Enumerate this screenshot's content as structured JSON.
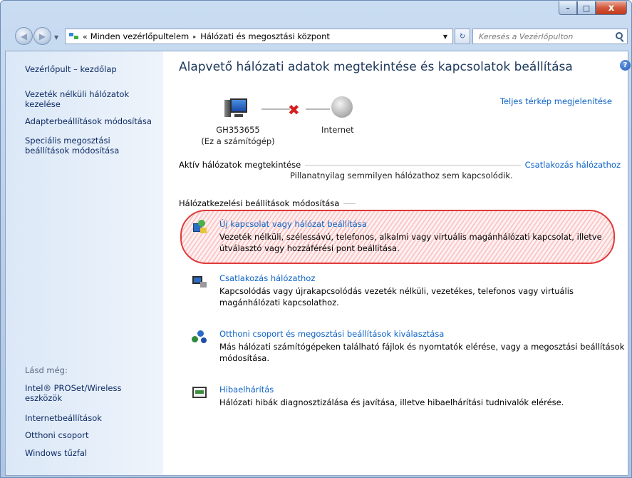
{
  "window": {
    "buttons": {
      "minimize": "–",
      "maximize": "□",
      "close": "x"
    }
  },
  "address": {
    "chevron": "«",
    "parts": [
      "Minden vezérlőpultelem",
      "Hálózati és megosztási központ"
    ],
    "separator": "▸"
  },
  "search": {
    "placeholder": "Keresés a Vezérlőpulton"
  },
  "sidebar": {
    "links": [
      "Vezérlőpult – kezdőlap",
      "Vezeték nélküli hálózatok kezelése",
      "Adapterbeállítások módosítása",
      "Speciális megosztási beállítások módosítása"
    ],
    "see_also_heading": "Lásd még:",
    "see_also": [
      "Intel® PROSet/Wireless eszközök",
      "Internetbeállítások",
      "Otthoni csoport",
      "Windows tűzfal"
    ]
  },
  "main": {
    "help": "?",
    "title": "Alapvető hálózati adatok megtekintése és kapcsolatok beállítása",
    "full_map_link": "Teljes térkép megjelenítése",
    "network_map": {
      "computer_name": "GH353655",
      "computer_sub": "(Ez a számítógép)",
      "internet_label": "Internet"
    },
    "active_networks": {
      "label": "Aktív hálózatok megtekintése",
      "connect_link": "Csatlakozás hálózathoz",
      "status": "Pillanatnyilag semmilyen hálózathoz sem kapcsolódik."
    },
    "settings_section": {
      "label": "Hálózatkezelési beállítások módosítása",
      "tasks": [
        {
          "title": "Új kapcsolat vagy hálózat beállítása",
          "desc": "Vezeték nélküli, szélessávú, telefonos, alkalmi vagy virtuális magánhálózati kapcsolat, illetve útválasztó vagy hozzáférési pont beállítása.",
          "icon": "new-connection-icon"
        },
        {
          "title": "Csatlakozás hálózathoz",
          "desc": "Kapcsolódás vagy újrakapcsolódás vezeték nélküli, vezetékes, telefonos vagy virtuális magánhálózati kapcsolathoz.",
          "icon": "connect-network-icon"
        },
        {
          "title": "Otthoni csoport és megosztási beállítások kiválasztása",
          "desc": "Más hálózati számítógépeken található fájlok és nyomtatók elérése, vagy a megosztási beállítások módosítása.",
          "icon": "homegroup-icon"
        },
        {
          "title": "Hibaelhárítás",
          "desc": "Hálózati hibák diagnosztizálása és javítása, illetve hibaelhárítási tudnivalók elérése.",
          "icon": "troubleshoot-icon"
        }
      ]
    }
  },
  "colors": {
    "link": "#0c63c8",
    "title": "#1e395b",
    "highlight": "#e03a3a",
    "sidebar_bg": "#e8f0fa"
  }
}
